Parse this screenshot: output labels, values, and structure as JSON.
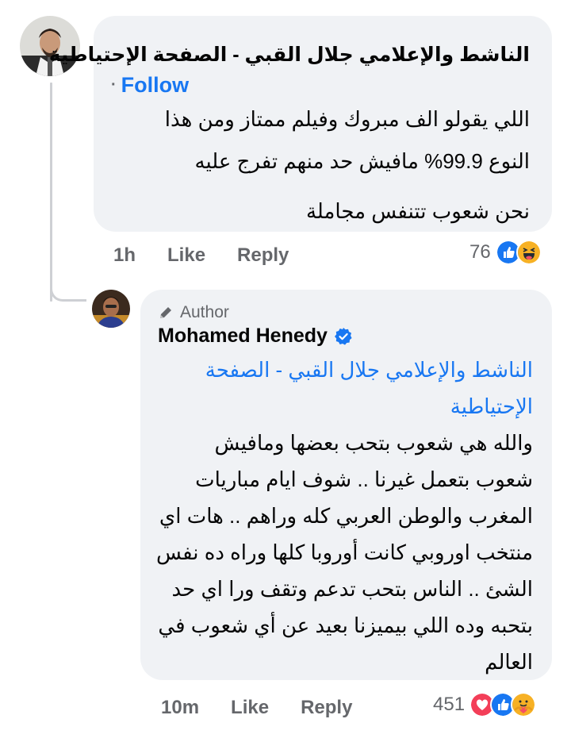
{
  "colors": {
    "bubble_bg": "#f0f2f5",
    "link": "#1877f2",
    "muted": "#65676b",
    "text": "#050505",
    "like_blue": "#1877f2",
    "love_red": "#f33e58",
    "haha_yellow": "#f7b125"
  },
  "comment": {
    "author_name": "الناشط والإعلامي جلال القبي - الصفحة الإحتياطية",
    "follow_label": "Follow",
    "text_lines": [
      "اللي يقولو الف مبروك وفيلم ممتاز ومن هذا",
      "النوع 99.9% مافيش حد منهم تفرج عليه"
    ],
    "text_last": "نحن شعوب تتنفس مجاملة",
    "time": "1h",
    "like_label": "Like",
    "reply_label": "Reply",
    "reaction_count": "76",
    "reactions": [
      "like-icon",
      "haha-icon"
    ]
  },
  "reply": {
    "badge_label": "Author",
    "author_name": "Mohamed Henedy",
    "mention": "الناشط والإعلامي جلال القبي - الصفحة الإحتياطية",
    "text": "والله هي شعوب بتحب بعضها ومافيش شعوب بتعمل غيرنا .. شوف ايام مباريات المغرب والوطن العربي كله وراهم .. هات اي منتخب اوروبي كانت أوروبا كلها وراه ده نفس الشئ .. الناس بتحب تدعم وتقف ورا اي حد بتحبه وده اللي بيميزنا بعيد عن أي شعوب في العالم",
    "time": "10m",
    "like_label": "Like",
    "reply_label": "Reply",
    "reaction_count": "451",
    "reactions": [
      "love-icon",
      "like-icon",
      "care-icon"
    ]
  }
}
